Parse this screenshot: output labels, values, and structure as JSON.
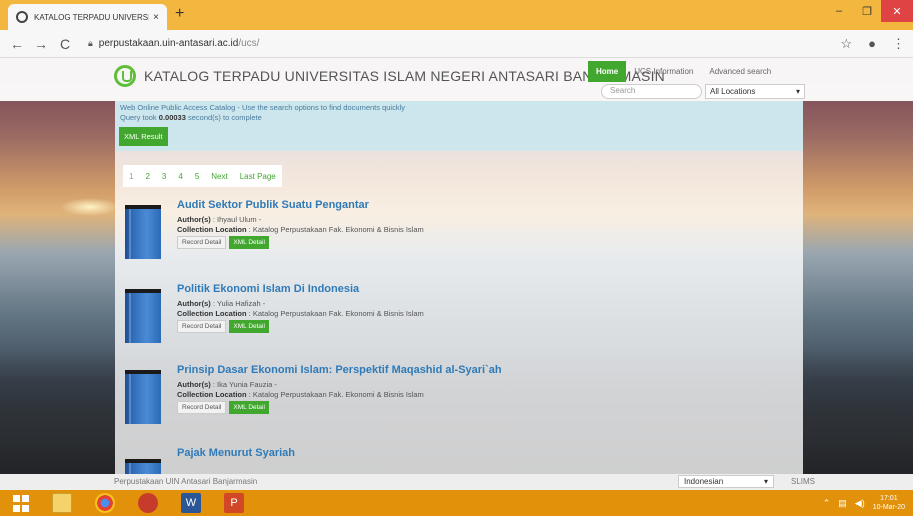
{
  "browser": {
    "tab_title": "KATALOG TERPADU UNIVERSITA",
    "tab_close": "×",
    "new_tab": "+",
    "url_host": "perpustakaan.uin-antasari.ac.id",
    "url_path": "/ucs/",
    "back": "←",
    "forward": "→",
    "reload": "C",
    "star": "☆",
    "account": "●",
    "menu": "⋮",
    "minimize": "–",
    "maximize": "❐",
    "close": "✕"
  },
  "header": {
    "site_title": "KATALOG TERPADU UNIVERSITAS ISLAM NEGERI ANTASARI BANJARMASIN",
    "menu": [
      "Home",
      "UCS Information",
      "Advanced search"
    ],
    "search_placeholder": "Search",
    "location_selected": "All Locations",
    "dropdown_arrow": "▾"
  },
  "info": {
    "line1": "Web Online Public Access Catalog - Use the search options to find documents quickly",
    "line2_prefix": "Query took ",
    "query_time": "0.00033",
    "line2_suffix": " second(s) to complete",
    "xml_result": "XML Result"
  },
  "pagination": [
    "1",
    "2",
    "3",
    "4",
    "5",
    "Next",
    "Last Page"
  ],
  "labels": {
    "author": "Author(s)",
    "collection": "Collection Location",
    "record_detail": "Record Detail",
    "xml_detail": "XML Detail"
  },
  "records": [
    {
      "title": "Audit Sektor Publik Suatu Pengantar",
      "author": " : Ihyaul Ulum - ",
      "location": " : Katalog Perpustakaan Fak. Ekonomi & Bisnis Islam"
    },
    {
      "title": "Politik Ekonomi Islam Di Indonesia",
      "author": " : Yulia Hafizah - ",
      "location": " : Katalog Perpustakaan Fak. Ekonomi & Bisnis Islam"
    },
    {
      "title": "Prinsip Dasar Ekonomi Islam: Perspektif Maqashid al-Syari`ah",
      "author": " : Ika Yunia Fauzia - ",
      "location": " : Katalog Perpustakaan Fak. Ekonomi & Bisnis Islam"
    },
    {
      "title": "Pajak Menurut Syariah"
    }
  ],
  "footer": {
    "left": "Perpustakaan UIN Antasari Banjarmasin",
    "language": "Indonesian",
    "slims": "SLIMS"
  },
  "taskbar": {
    "word": "W",
    "ppt": "P",
    "time": "17:01",
    "date": "10-Mar-20"
  },
  "colors": {
    "accent_green": "#42a72f",
    "title_blue": "#2f7ab8",
    "tab_strip": "#f3b73f",
    "taskbar": "#e2910b"
  }
}
